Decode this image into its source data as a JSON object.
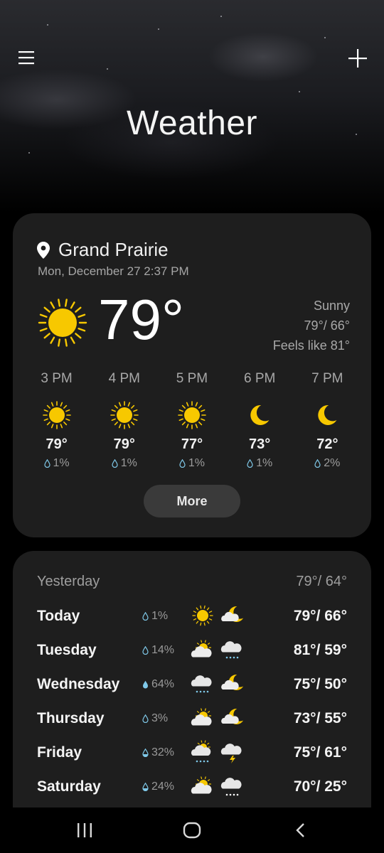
{
  "header": {
    "title": "Weather",
    "menu_icon": "hamburger-menu-icon",
    "add_icon": "plus-icon"
  },
  "current": {
    "location": "Grand Prairie",
    "datetime": "Mon, December 27 2:37 PM",
    "temp": "79°",
    "condition": "Sunny",
    "high_low": "79°/ 66°",
    "feels_like": "Feels like 81°",
    "icon": "sun-icon"
  },
  "hourly": [
    {
      "time": "3 PM",
      "icon": "sun",
      "temp": "79°",
      "rain": "1%"
    },
    {
      "time": "4 PM",
      "icon": "sun",
      "temp": "79°",
      "rain": "1%"
    },
    {
      "time": "5 PM",
      "icon": "sun",
      "temp": "77°",
      "rain": "1%"
    },
    {
      "time": "6 PM",
      "icon": "moon",
      "temp": "73°",
      "rain": "1%"
    },
    {
      "time": "7 PM",
      "icon": "moon",
      "temp": "72°",
      "rain": "2%"
    }
  ],
  "more_label": "More",
  "forecast": {
    "yesterday": {
      "label": "Yesterday",
      "temps": "79°/ 64°"
    },
    "days": [
      {
        "name": "Today",
        "rain": "1%",
        "drop": "outline",
        "day_icon": "sun",
        "night_icon": "cloud-moon",
        "temps": "79°/ 66°"
      },
      {
        "name": "Tuesday",
        "rain": "14%",
        "drop": "outline",
        "day_icon": "partly-cloudy",
        "night_icon": "cloud-rain",
        "temps": "81°/ 59°"
      },
      {
        "name": "Wednesday",
        "rain": "64%",
        "drop": "full",
        "day_icon": "cloud-rain",
        "night_icon": "cloud-moon",
        "temps": "75°/ 50°"
      },
      {
        "name": "Thursday",
        "rain": "3%",
        "drop": "outline",
        "day_icon": "partly-cloudy",
        "night_icon": "cloud-moon",
        "temps": "73°/ 55°"
      },
      {
        "name": "Friday",
        "rain": "32%",
        "drop": "half",
        "day_icon": "sun-cloud-rain",
        "night_icon": "cloud-thunder",
        "temps": "75°/ 61°"
      },
      {
        "name": "Saturday",
        "rain": "24%",
        "drop": "half",
        "day_icon": "partly-cloudy",
        "night_icon": "cloud-snow",
        "temps": "70°/ 25°"
      }
    ]
  },
  "navbar": {
    "recents_icon": "recent-apps-icon",
    "home_icon": "home-icon",
    "back_icon": "back-icon"
  },
  "colors": {
    "sun": "#f7c800",
    "moon": "#f7c800",
    "cloud": "#e8e8e8",
    "rain_drop": "#7fc8e8",
    "card_bg": "#1e1e1e",
    "button_bg": "#3a3a3a"
  }
}
